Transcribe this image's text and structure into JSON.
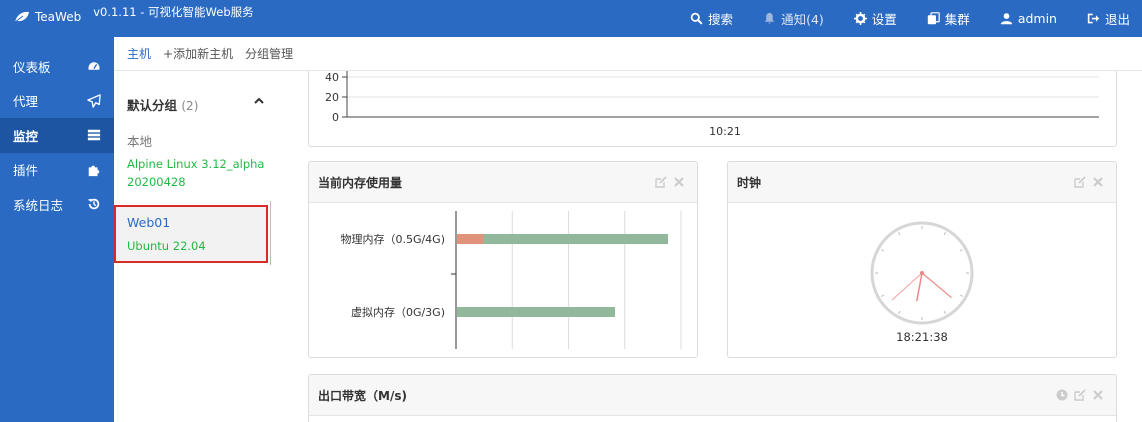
{
  "topbar": {
    "brand": "TeaWeb",
    "version": "v0.1.11 - 可视化智能Web服务",
    "menu": [
      {
        "label": "搜索",
        "icon": "search-icon"
      },
      {
        "label": "通知(4)",
        "icon": "bell-icon"
      },
      {
        "label": "设置",
        "icon": "gear-icon"
      },
      {
        "label": "集群",
        "icon": "cluster-icon"
      },
      {
        "label": "admin",
        "icon": "user-icon"
      },
      {
        "label": "退出",
        "icon": "logout-icon"
      }
    ]
  },
  "sidebar": {
    "items": [
      {
        "label": "仪表板",
        "icon": "dashboard-icon",
        "active": false
      },
      {
        "label": "代理",
        "icon": "paper-plane-icon",
        "active": false
      },
      {
        "label": "监控",
        "icon": "server-icon",
        "active": true
      },
      {
        "label": "插件",
        "icon": "puzzle-icon",
        "active": false
      },
      {
        "label": "系统日志",
        "icon": "history-icon",
        "active": false
      }
    ]
  },
  "subnav": {
    "items": [
      "主机",
      "+添加新主机",
      "分组管理"
    ]
  },
  "group": {
    "title": "默认分组",
    "count": "(2)",
    "local_label": "本地",
    "hosts": [
      {
        "name": "",
        "os": "Alpine Linux 3.12_alpha 20200428"
      },
      {
        "name": "Web01",
        "os": "Ubuntu 22.04"
      }
    ]
  },
  "top_chart": {
    "y_ticks": [
      "40",
      "20",
      "0"
    ],
    "x_label": "10:21"
  },
  "memory_card": {
    "title": "当前内存使用量",
    "colors": {
      "used": "#e0937a",
      "total": "#92b89c"
    }
  },
  "clock_card": {
    "title": "时钟",
    "time": "18:21:38"
  },
  "bandwidth_card": {
    "title": "出口带宽（M/s)"
  },
  "chart_data": {
    "type": "bar",
    "orientation": "horizontal",
    "categories": [
      "物理内存（0.5G/4G)",
      "虚拟内存（0G/3G)"
    ],
    "series": [
      {
        "values": [
          0.5,
          0
        ]
      },
      {
        "values": [
          4,
          3
        ]
      }
    ],
    "xlim": [
      0,
      4
    ]
  }
}
